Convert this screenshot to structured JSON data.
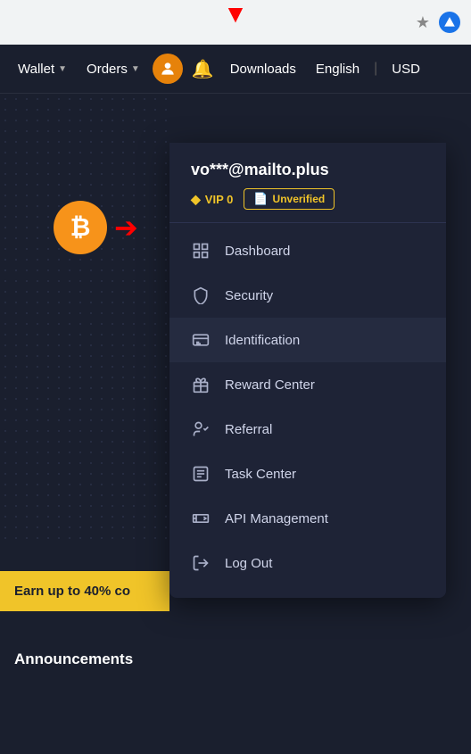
{
  "browser": {
    "star_icon": "★",
    "brand_icon": "▲"
  },
  "navbar": {
    "wallet_label": "Wallet",
    "orders_label": "Orders",
    "downloads_label": "Downloads",
    "english_label": "English",
    "usd_label": "USD"
  },
  "dropdown": {
    "email": "vo***@mailto.plus",
    "vip_label": "VIP 0",
    "unverified_label": "Unverified",
    "menu_items": [
      {
        "id": "dashboard",
        "label": "Dashboard",
        "icon": "dashboard"
      },
      {
        "id": "security",
        "label": "Security",
        "icon": "security"
      },
      {
        "id": "identification",
        "label": "Identification",
        "icon": "identification"
      },
      {
        "id": "reward-center",
        "label": "Reward Center",
        "icon": "reward"
      },
      {
        "id": "referral",
        "label": "Referral",
        "icon": "referral"
      },
      {
        "id": "task-center",
        "label": "Task Center",
        "icon": "task"
      },
      {
        "id": "api-management",
        "label": "API Management",
        "icon": "api"
      },
      {
        "id": "log-out",
        "label": "Log Out",
        "icon": "logout"
      }
    ]
  },
  "page": {
    "yellow_banner_text": "Earn up to 40% co",
    "announcements_label": "Announcements"
  },
  "icons": {
    "bitcoin_symbol": "₿",
    "red_down_arrow": "▼",
    "red_right_arrow": "→"
  }
}
